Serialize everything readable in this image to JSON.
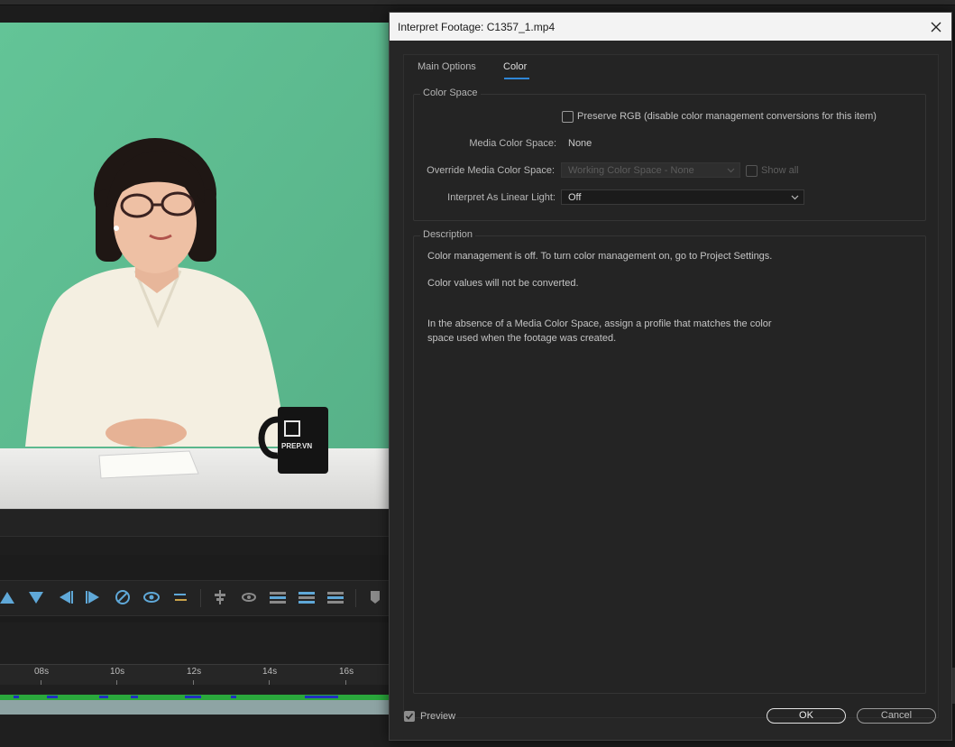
{
  "dialog": {
    "title": "Interpret Footage: C1357_1.mp4",
    "tabs": [
      {
        "label": "Main Options",
        "selected": false
      },
      {
        "label": "Color",
        "selected": true
      }
    ],
    "color_space": {
      "legend": "Color Space",
      "preserve_rgb": {
        "label": "Preserve RGB (disable color management conversions for this item)",
        "checked": false
      },
      "media_color_space": {
        "label": "Media Color Space:",
        "value": "None"
      },
      "override_media_color_space": {
        "label": "Override Media Color Space:",
        "value": "Working Color Space - None",
        "disabled": true
      },
      "show_all": {
        "label": "Show all",
        "checked": false,
        "disabled": true
      },
      "interpret_linear_light": {
        "label": "Interpret As Linear Light:",
        "value": "Off"
      }
    },
    "description": {
      "legend": "Description",
      "lines": [
        "Color management is off. To turn color management on, go to Project Settings.",
        "Color values will not be converted.",
        "In the absence of a Media Color Space, assign a profile that matches the color",
        "space used when the footage was created."
      ]
    },
    "preview": {
      "label": "Preview",
      "checked": true
    },
    "buttons": {
      "ok": "OK",
      "cancel": "Cancel"
    }
  },
  "viewer": {
    "mug_brand": "PREP.VN"
  },
  "timeline": {
    "ruler_labels": [
      "08s",
      "10s",
      "12s",
      "14s",
      "16s"
    ]
  },
  "colors": {
    "accent": "#2f86d6",
    "viewer_background": "#5ebd92",
    "track_green": "#2aa83c",
    "track_blue": "#2030c0"
  }
}
